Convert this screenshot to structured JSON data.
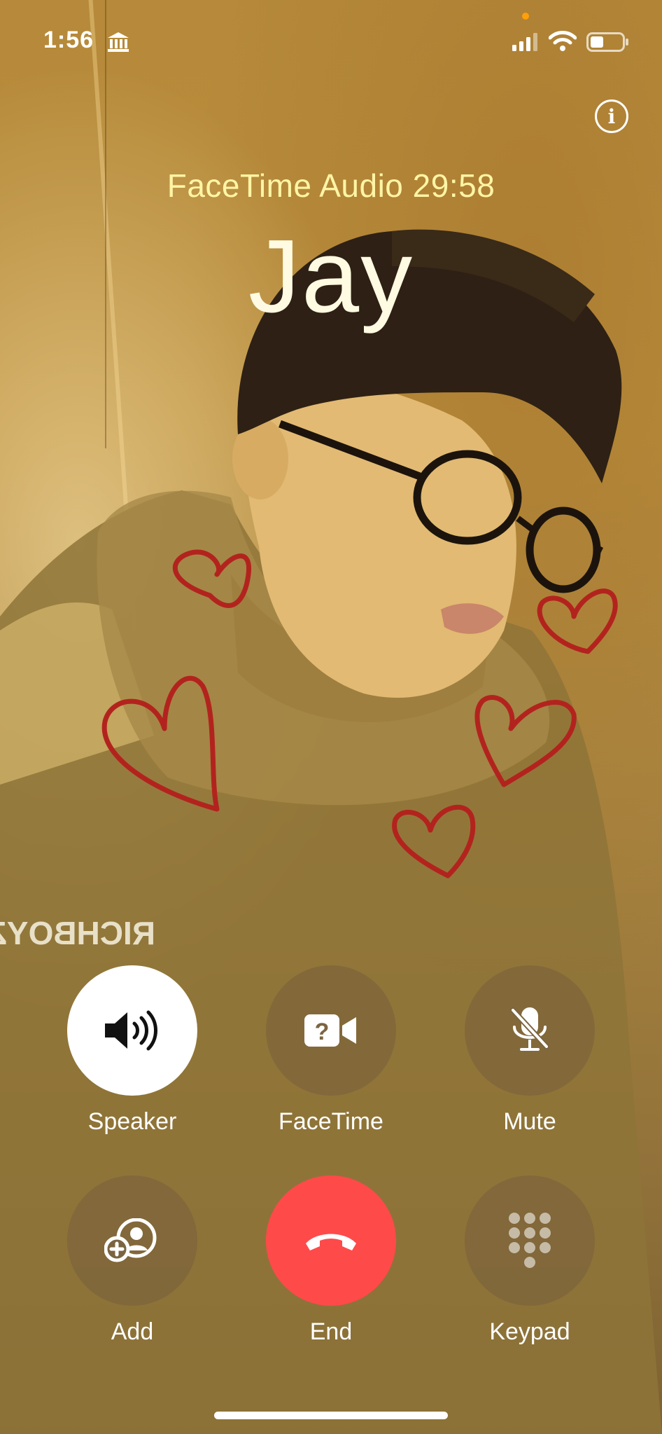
{
  "status_bar": {
    "time": "1:56",
    "bank_icon": "bank-icon",
    "signal_icon": "cellular-signal-icon",
    "wifi_icon": "wifi-icon",
    "battery_icon": "battery-icon"
  },
  "info_button": {
    "icon": "info-icon",
    "glyph": "i"
  },
  "call": {
    "status": "FaceTime Audio 29:58",
    "name": "Jay"
  },
  "background": {
    "shirt_text": "RICHBOYZ"
  },
  "controls": [
    {
      "id": "speaker",
      "label": "Speaker",
      "icon": "speaker-icon",
      "active": true
    },
    {
      "id": "facetime",
      "label": "FaceTime",
      "icon": "facetime-video-icon",
      "active": false
    },
    {
      "id": "mute",
      "label": "Mute",
      "icon": "mute-mic-icon",
      "active": false
    },
    {
      "id": "add",
      "label": "Add",
      "icon": "add-person-icon",
      "active": false
    },
    {
      "id": "end",
      "label": "End",
      "icon": "end-call-icon",
      "active": false
    },
    {
      "id": "keypad",
      "label": "Keypad",
      "icon": "keypad-icon",
      "active": false
    }
  ],
  "colors": {
    "call_status": "#fff5a6",
    "end_button": "#ff4a4a",
    "heart_doodles": "#b3231e"
  }
}
